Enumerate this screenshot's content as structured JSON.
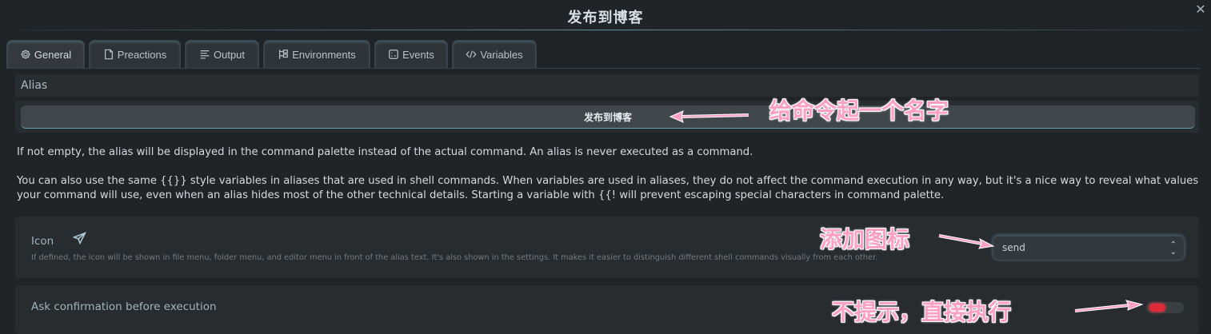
{
  "window": {
    "title": "发布到博客",
    "close_glyph": "✕"
  },
  "tabs": [
    {
      "label": "General",
      "icon": "gear-icon"
    },
    {
      "label": "Preactions",
      "icon": "document-icon"
    },
    {
      "label": "Output",
      "icon": "lines-icon"
    },
    {
      "label": "Environments",
      "icon": "tree-icon"
    },
    {
      "label": "Events",
      "icon": "events-icon"
    },
    {
      "label": "Variables",
      "icon": "code-icon"
    }
  ],
  "active_tab": "General",
  "alias": {
    "label": "Alias",
    "value": "发布到博客",
    "desc1": "If not empty, the alias will be displayed in the command palette instead of the actual command. An alias is never executed as a command.",
    "desc2": "You can also use the same {{}} style variables in aliases that are used in shell commands. When variables are used in aliases, they do not affect the command execution in any way, but it's a nice way to reveal what values your command will use, even when an alias hides most of the other technical details. Starting a variable with {{! will prevent escaping special characters in command palette."
  },
  "icon_setting": {
    "label": "Icon",
    "icon": "send-icon",
    "description": "If defined, the icon will be shown in file menu, folder menu, and editor menu in front of the alias text. It's also shown in the settings. It makes it easier to distinguish different shell commands visually from each other.",
    "selected": "send"
  },
  "ask_setting": {
    "label": "Ask confirmation before execution",
    "toggle_on": false,
    "toggle_color": "#e02a3a"
  },
  "annotations": {
    "alias_note": "给命令起一个名字",
    "icon_note": "添加图标",
    "toggle_note": "不提示，直接执行",
    "color": "#ff9fc2"
  }
}
